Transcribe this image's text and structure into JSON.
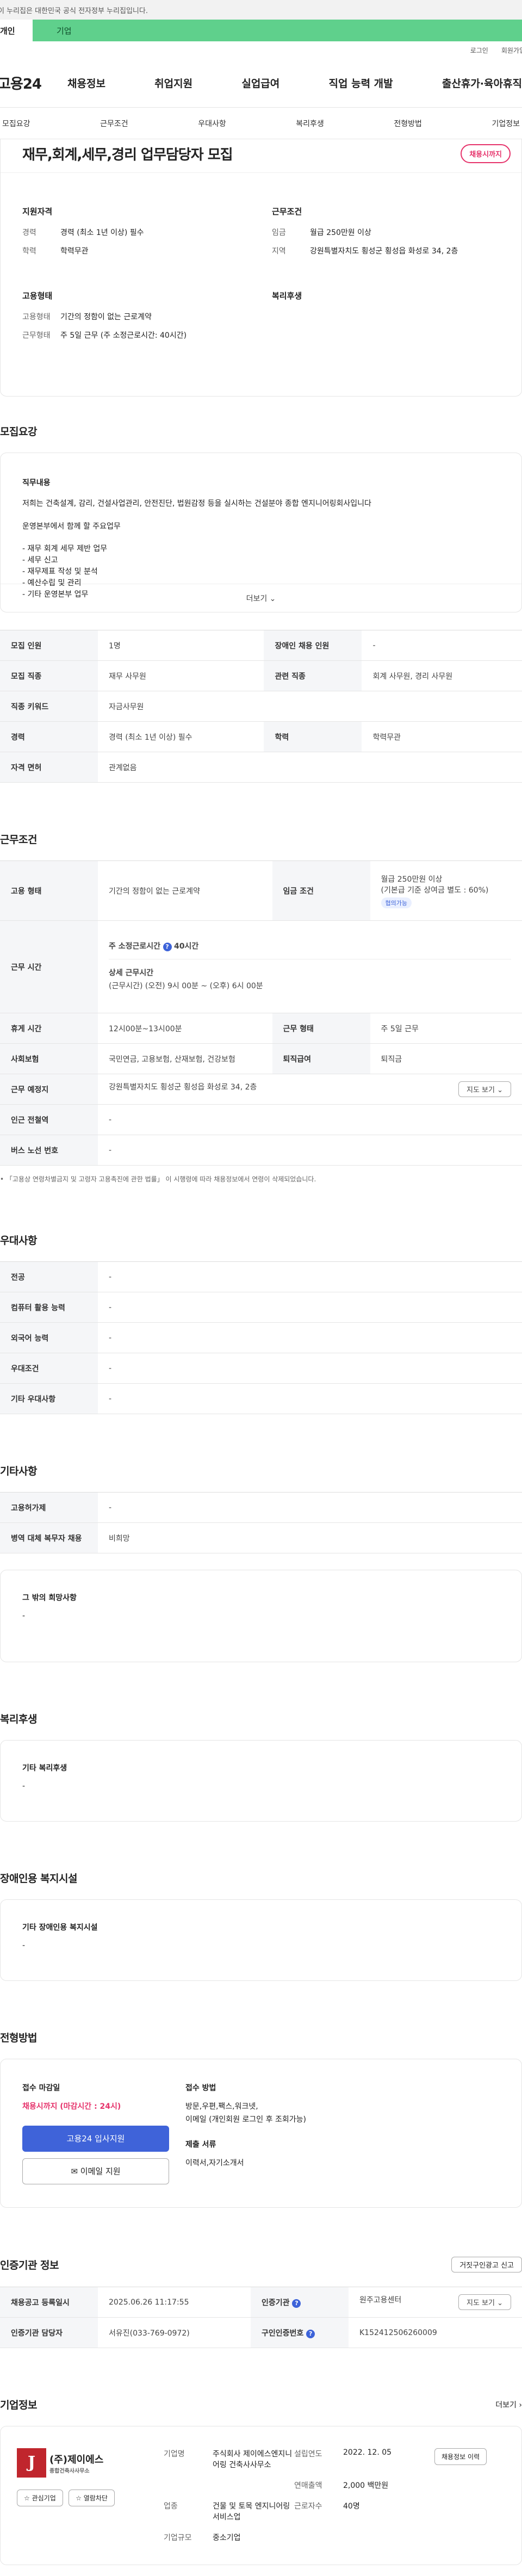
{
  "gov_banner": "이 누리집은 대한민국 공식 전자정부 누리집입니다.",
  "usertype": {
    "individual": "개인",
    "business": "기업"
  },
  "topmini": {
    "login": "로그인",
    "signup": "회원가입"
  },
  "site": {
    "logo": "고용24"
  },
  "gnb": [
    "채용정보",
    "취업지원",
    "실업급여",
    "직업 능력 개발",
    "출산휴가·육아휴직"
  ],
  "subtabs": [
    "모집요강",
    "근무조건",
    "우대사항",
    "복리후생",
    "전형방법",
    "기업정보"
  ],
  "job": {
    "title": "재무,회계,세무,경리 업무담당자 모집",
    "badge": "채용시까지"
  },
  "summary": {
    "qual_title": "지원자격",
    "career_k": "경력",
    "career_v": "경력 (최소 1년 이상) 필수",
    "edu_k": "학력",
    "edu_v": "학력무관",
    "work_title": "근무조건",
    "wage_k": "임금",
    "wage_v": "월급 250만원 이상",
    "region_k": "지역",
    "region_v": "강원특별자치도 횡성군 횡성읍 화성로 34, 2층",
    "emp_title": "고용형태",
    "emptype_k": "고용형태",
    "emptype_v": "기간의 정함이 없는 근로계약",
    "worktype_k": "근무형태",
    "worktype_v": "주 5일 근무 (주 소정근로시간: 40시간)",
    "welfare_title": "복리후생"
  },
  "recruit": {
    "heading": "모집요강",
    "desc_title": "직무내용",
    "desc_p1": "저희는 건축설계, 감리, 건설사업관리, 안전진단, 법원감정 등을 실시하는 건설분야 종합 엔지니어링회사입니다",
    "desc_p2": "운영본부에서 함께 할 주요업무",
    "desc_items": [
      "- 재무 회계 세무 제반 업무",
      "- 세무 신고",
      "- 재무제표 작성 및 분석",
      "- 예산수립 및 관리",
      "- 기타 운영본부 업무"
    ],
    "more": "더보기 ⌄",
    "rows": [
      {
        "k1": "모집 인원",
        "v1": "1명",
        "k2": "장애인 채용 인원",
        "v2": "-"
      },
      {
        "k1": "모집 직종",
        "v1": "재무 사무원",
        "k2": "관련 직종",
        "v2": "회계 사무원, 경리 사무원"
      },
      {
        "k1": "직종 키워드",
        "v1": "자금사무원",
        "k2": "",
        "v2": ""
      },
      {
        "k1": "경력",
        "v1": "경력 (최소 1년 이상) 필수",
        "k2": "학력",
        "v2": "학력무관"
      },
      {
        "k1": "자격 면허",
        "v1": "관계없음",
        "k2": "",
        "v2": ""
      }
    ]
  },
  "conditions": {
    "heading": "근무조건",
    "emp_k": "고용 형태",
    "emp_v": "기간의 정함이 없는 근로계약",
    "wage_k": "임금 조건",
    "wage_v1": "월급 250만원 이상",
    "wage_v2": "(기본급 기준 상여금 별도 : 60%)",
    "wage_pill": "협의가능",
    "hours_k": "근무 시간",
    "hours_v1": "주 소정근로시간",
    "hours_v1b": "40시간",
    "hours_v2": "상세 근무시간",
    "hours_v3": "(근무시간) (오전) 9시 00분 ~ (오후) 6시 00분",
    "break_k": "휴게 시간",
    "break_v": "12시00분~13시00분",
    "form_k": "근무 형태",
    "form_v": "주 5일 근무",
    "ins_k": "사회보험",
    "ins_v": "국민연금, 고용보험, 산재보험, 건강보험",
    "sev_k": "퇴직급여",
    "sev_v": "퇴직금",
    "place_k": "근무 예정지",
    "place_v": "강원특별자치도 횡성군 횡성읍 화성로 34, 2층",
    "map_btn": "지도 보기 ⌄",
    "subway_k": "인근 전철역",
    "subway_v": "-",
    "bus_k": "버스 노선 번호",
    "bus_v": "-",
    "note": "• 「고용상 연령차별금지 및 고령자 고용촉진에 관한 법률」 이 시행령에 따라 채용정보에서 연령이 삭제되었습니다."
  },
  "pref": {
    "heading": "우대사항",
    "rows": [
      {
        "k": "전공",
        "v": "-"
      },
      {
        "k": "컴퓨터 활용 능력",
        "v": "-"
      },
      {
        "k": "외국어 능력",
        "v": "-"
      },
      {
        "k": "우대조건",
        "v": "-"
      },
      {
        "k": "기타 우대사항",
        "v": "-"
      }
    ]
  },
  "etc": {
    "heading": "기타사항",
    "rows": [
      {
        "k": "고용허가제",
        "v": "-"
      },
      {
        "k": "병역 대체 복무자 채용",
        "v": "비희망"
      }
    ],
    "other_title": "그 밖의 희망사항",
    "other_v": "-"
  },
  "welfare": {
    "heading": "복리후생",
    "title": "기타 복리후생",
    "v": "-"
  },
  "disabled": {
    "heading": "장애인용 복지시설",
    "title": "기타 장애인용 복지시설",
    "v": "-"
  },
  "apply": {
    "heading": "전형방법",
    "deadline_title": "접수 마감일",
    "deadline_v": "채용시까지 (마감시간 : 24시)",
    "btn_apply": "고용24 입사지원",
    "btn_email": "✉ 이메일 지원",
    "method_title": "접수 방법",
    "method_v1": "방문,우편,팩스,워크넷,",
    "method_v2": "이메일 (개인회원 로그인 후 조회가능)",
    "docs_title": "제출 서류",
    "docs_v": "이력서,자기소개서"
  },
  "cert": {
    "heading": "인증기관 정보",
    "report_btn": "거짓구인광고 신고",
    "rows": [
      {
        "k1": "채용공고 등록일시",
        "v1": "2025.06.26 11:17:55",
        "k2": "인증기관",
        "v2": "원주고용센터",
        "btn": "지도 보기 ⌄"
      },
      {
        "k1": "인증기관 담당자",
        "v1": "서유진(033-769-0972)",
        "k2": "구인인증번호",
        "v2": "K152412506260009",
        "btn": ""
      }
    ]
  },
  "company": {
    "heading": "기업정보",
    "more": "더보기 ›",
    "logo_mark": "J",
    "logo_name": "(주)제이에스",
    "logo_sub": "종합건축사사무소",
    "btn_fav": "☆ 관심기업",
    "btn_block": "☆ 열람차단",
    "name_k": "기업명",
    "name_v": "주식회사 제이에스엔지니어링 건축사사무소",
    "est_k": "설립연도",
    "est_v": "2022. 12. 05",
    "sales_k": "연매출액",
    "sales_v": "2,000 백만원",
    "ind_k": "업종",
    "ind_v": "건물 및 토목 엔지니어링 서비스업",
    "emp_k": "근로자수",
    "emp_v": "40명",
    "size_k": "기업규모",
    "size_v": "중소기업",
    "jobs_btn": "채용정보 이력"
  }
}
